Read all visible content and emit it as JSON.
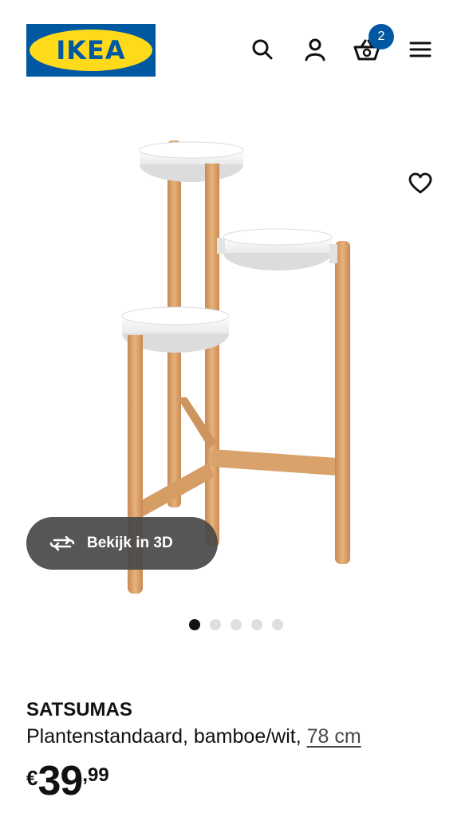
{
  "header": {
    "logo_text": "IKEA",
    "basket_count": "2",
    "icons": [
      "search-icon",
      "account-icon",
      "basket-icon",
      "menu-icon"
    ]
  },
  "gallery": {
    "favourite_icon": "heart-icon",
    "view3d_icon": "rotate-3d-icon",
    "view3d_label": "Bekijk in 3D",
    "dots_total": 5,
    "active_dot": 1
  },
  "product": {
    "name": "SATSUMAS",
    "description": "Plantenstandaard, bamboe/wit, ",
    "size_link": "78 cm",
    "price_currency": "€",
    "price_integer": "39",
    "price_decimal": ",99"
  },
  "colors": {
    "brand_blue": "#0058a3",
    "brand_yellow": "#ffda1a",
    "bamboo": "#d9a26a",
    "dot_active": "#111111",
    "dot_inactive": "#dfdfdf"
  }
}
